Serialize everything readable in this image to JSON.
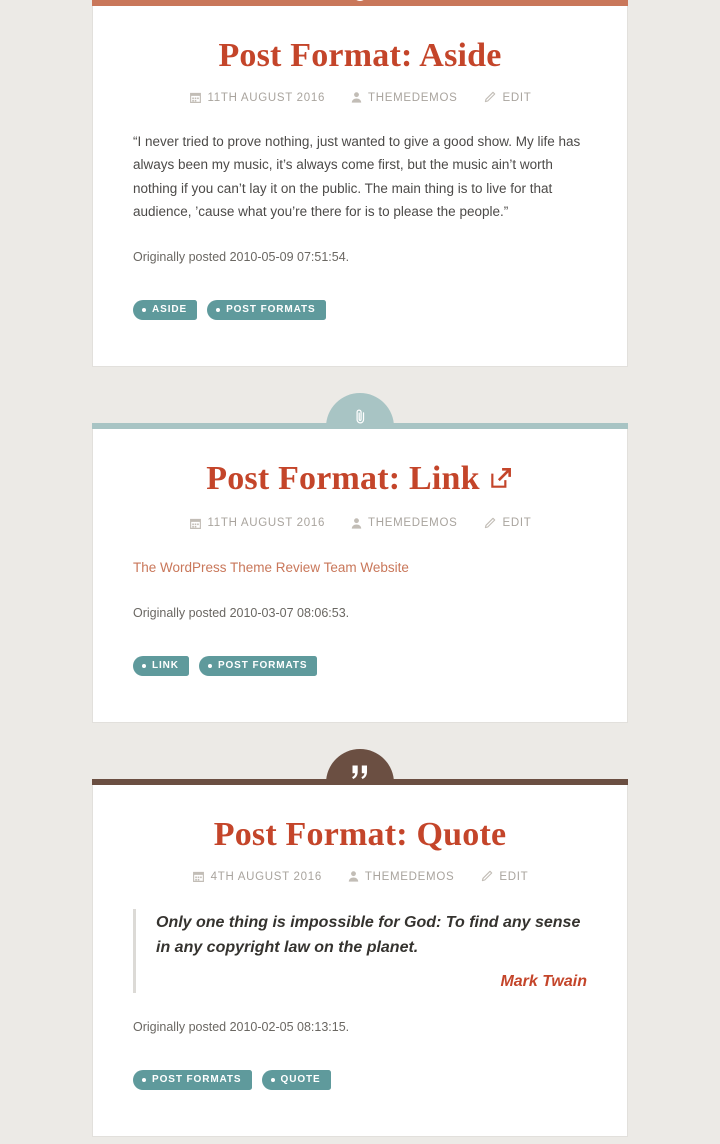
{
  "theme": {
    "page_background": "#eceae6",
    "card_background": "#ffffff",
    "title_color": "#c4452a",
    "tag_color": "#5f9a9c",
    "meta_color": "#a9a49e"
  },
  "posts": [
    {
      "format": "aside",
      "accent_color": "#c9775a",
      "badge_icon": "aside-dot-icon",
      "title": "Post Format: Aside",
      "has_external_link_icon": false,
      "meta": {
        "date_icon": "calendar-icon",
        "date": "11th August 2016",
        "author_icon": "user-icon",
        "author": "themedemos",
        "edit_icon": "pencil-icon",
        "edit": "Edit"
      },
      "body": {
        "paragraph": "“I never tried to prove nothing, just wanted to give a good show. My life has always been my music, it’s always come first, but the music ain’t worth nothing if you can’t lay it on the public. The main thing is to live for that audience, ’cause what you’re there for is to please the people.”",
        "origin": "Originally posted 2010-05-09 07:51:54."
      },
      "tags": [
        "Aside",
        "Post Formats"
      ]
    },
    {
      "format": "link",
      "accent_color": "#a8c4c4",
      "badge_icon": "paperclip-icon",
      "title": "Post Format: Link",
      "has_external_link_icon": true,
      "external_link_icon": "external-link-icon",
      "meta": {
        "date_icon": "calendar-icon",
        "date": "11th August 2016",
        "author_icon": "user-icon",
        "author": "themedemos",
        "edit_icon": "pencil-icon",
        "edit": "Edit"
      },
      "body": {
        "link_text": "The WordPress Theme Review Team Website",
        "origin": "Originally posted 2010-03-07 08:06:53."
      },
      "tags": [
        "Link",
        "Post Formats"
      ]
    },
    {
      "format": "quote",
      "accent_color": "#6b4f42",
      "badge_icon": "quote-marks-icon",
      "title": "Post Format: Quote",
      "has_external_link_icon": false,
      "meta": {
        "date_icon": "calendar-icon",
        "date": "4th August 2016",
        "author_icon": "user-icon",
        "author": "themedemos",
        "edit_icon": "pencil-icon",
        "edit": "Edit"
      },
      "body": {
        "quote": "Only one thing is impossible for God: To find any sense in any copyright law on the planet.",
        "cite": "Mark Twain",
        "origin": "Originally posted 2010-02-05 08:13:15."
      },
      "tags": [
        "Post Formats",
        "Quote"
      ]
    }
  ]
}
